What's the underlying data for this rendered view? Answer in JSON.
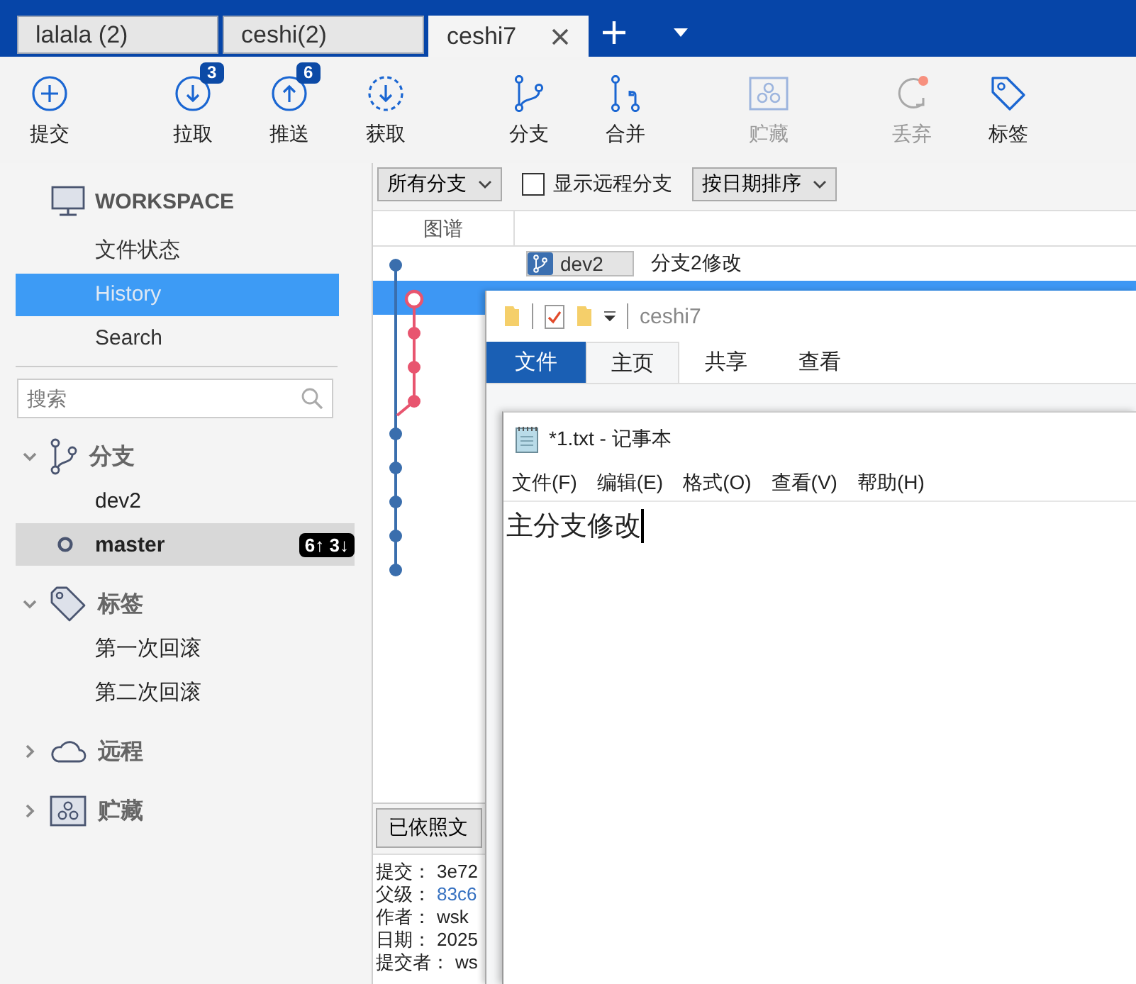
{
  "tabs": [
    {
      "label": "lalala (2)",
      "selected": false
    },
    {
      "label": "ceshi(2)",
      "selected": false
    },
    {
      "label": "ceshi7",
      "selected": true
    }
  ],
  "toolbar": [
    {
      "kind": "commit",
      "label": "提交",
      "disabled": false
    },
    {
      "kind": "pull",
      "label": "拉取",
      "badge": "3",
      "disabled": false
    },
    {
      "kind": "push",
      "label": "推送",
      "badge": "6",
      "disabled": false
    },
    {
      "kind": "fetch",
      "label": "获取",
      "disabled": false
    },
    {
      "kind": "branch",
      "label": "分支",
      "disabled": false
    },
    {
      "kind": "merge",
      "label": "合并",
      "disabled": false
    },
    {
      "kind": "stash",
      "label": "贮藏",
      "disabled": true
    },
    {
      "kind": "discard",
      "label": "丢弃",
      "disabled": true
    },
    {
      "kind": "tag",
      "label": "标签",
      "disabled": false
    }
  ],
  "sidebar": {
    "workspace": "WORKSPACE",
    "views": [
      {
        "label": "文件状态",
        "selected": false
      },
      {
        "label": "History",
        "selected": true
      },
      {
        "label": "Search",
        "selected": false
      }
    ],
    "search": {
      "placeholder": "搜索"
    },
    "sections": [
      {
        "kind": "branches",
        "label": "分支",
        "expanded": true,
        "items": [
          {
            "label": "dev2",
            "current": false
          },
          {
            "label": "master",
            "current": true,
            "ahead_behind": "6↑ 3↓"
          }
        ]
      },
      {
        "kind": "tags",
        "label": "标签",
        "expanded": true,
        "items": [
          {
            "label": "第一次回滚",
            "current": false
          },
          {
            "label": "第二次回滚",
            "current": false
          }
        ]
      },
      {
        "kind": "remotes",
        "label": "远程",
        "expanded": false
      },
      {
        "kind": "stashes",
        "label": "贮藏",
        "expanded": false
      }
    ]
  },
  "filter": {
    "branches": "所有分支",
    "show_remote": {
      "label": "显示远程分支",
      "checked": false
    },
    "sort": "按日期排序"
  },
  "history": {
    "graph_column": "图谱",
    "commits": [
      {
        "branch": "dev2",
        "message": "分支2修改",
        "selected": false
      },
      {
        "selected": true
      }
    ]
  },
  "details": {
    "button": "已依照文",
    "fields": [
      {
        "label": "提交：",
        "value": "3e72",
        "link": false
      },
      {
        "label": "父级：",
        "value": "83c6",
        "link": true
      },
      {
        "label": "作者：",
        "value": "wsk",
        "link": false
      },
      {
        "label": "日期：",
        "value": "2025",
        "link": false
      },
      {
        "label": "提交者：",
        "value": "ws",
        "link": false
      }
    ]
  },
  "explorer": {
    "title": "ceshi7",
    "tabs": [
      {
        "kind": "file",
        "label": "文件",
        "selected": false
      },
      {
        "kind": "tab",
        "label": "主页",
        "selected": true
      },
      {
        "kind": "tab",
        "label": "共享",
        "selected": false
      },
      {
        "kind": "tab",
        "label": "查看",
        "selected": false
      }
    ]
  },
  "notepad": {
    "title": "*1.txt - 记事本",
    "menu": [
      "文件(F)",
      "编辑(E)",
      "格式(O)",
      "查看(V)",
      "帮助(H)"
    ],
    "text": "主分支修改"
  }
}
